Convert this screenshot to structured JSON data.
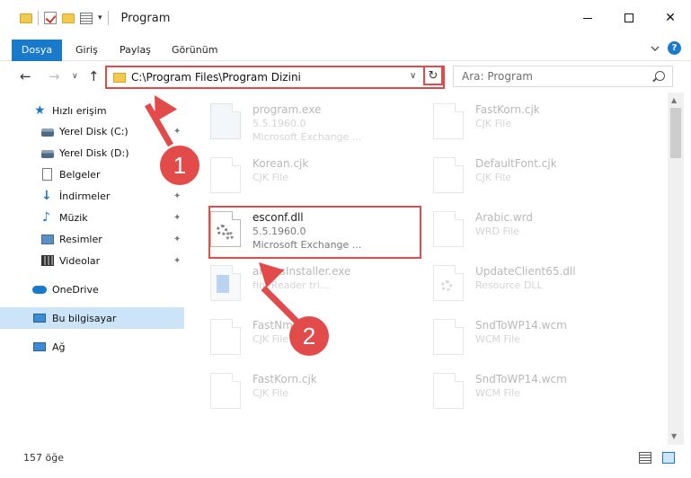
{
  "window": {
    "title": "Program",
    "minimize": "—",
    "close": "✕"
  },
  "ribbon": {
    "tabs": [
      "Dosya",
      "Giriş",
      "Paylaş",
      "Görünüm"
    ],
    "help": "?"
  },
  "nav": {
    "back": "←",
    "forward": "→",
    "recent": "∨",
    "up": "↑",
    "address": "C:\\Program Files\\Program Dizini",
    "address_dropdown": "∨",
    "refresh": "↻",
    "search_placeholder": "Ara: Program"
  },
  "sidebar": {
    "items": [
      {
        "label": "Hızlı erişim",
        "icon": "star-icon",
        "pinned": false
      },
      {
        "label": "Yerel Disk (C:)",
        "icon": "drive-icon",
        "pinned": true
      },
      {
        "label": "Yerel Disk (D:)",
        "icon": "drive-icon",
        "pinned": false
      },
      {
        "label": "Belgeler",
        "icon": "document-icon",
        "pinned": false
      },
      {
        "label": "İndirmeler",
        "icon": "download-icon",
        "pinned": true
      },
      {
        "label": "Müzik",
        "icon": "music-icon",
        "pinned": true
      },
      {
        "label": "Resimler",
        "icon": "pictures-icon",
        "pinned": true
      },
      {
        "label": "Videolar",
        "icon": "video-icon",
        "pinned": true
      },
      {
        "label": "OneDrive",
        "icon": "cloud-icon",
        "pinned": false
      },
      {
        "label": "Bu bilgisayar",
        "icon": "computer-icon",
        "pinned": false
      },
      {
        "label": "Ağ",
        "icon": "network-icon",
        "pinned": false
      }
    ],
    "pin_glyph": "📌"
  },
  "files": [
    {
      "name": "program.exe",
      "type": "5.5.1960.0",
      "desc": "Microsoft Exchange ..."
    },
    {
      "name": "FastKorn.cjk",
      "type": "CJK File",
      "desc": ""
    },
    {
      "name": "Korean.cjk",
      "type": "CJK File",
      "desc": ""
    },
    {
      "name": "DefaultFont.cjk",
      "type": "CJK File",
      "desc": ""
    },
    {
      "name": "esconf.dll",
      "type": "5.5.1960.0",
      "desc": "Microsoft Exchange ..."
    },
    {
      "name": "Arabic.wrd",
      "type": "WRD File",
      "desc": ""
    },
    {
      "name": "ammsInstaller.exe",
      "type": "fineReader tri...",
      "desc": ""
    },
    {
      "name": "UpdateClient65.dll",
      "type": "Resource DLL",
      "desc": ""
    },
    {
      "name": "FastNm",
      "type": "CJK File",
      "desc": ""
    },
    {
      "name": "SndToWP14.wcm",
      "type": "WCM File",
      "desc": ""
    },
    {
      "name": "FastKorn.cjk",
      "type": "CJK File",
      "desc": ""
    },
    {
      "name": "SndToWP14.wcm",
      "type": "WCM File",
      "desc": ""
    }
  ],
  "annotations": {
    "step1": "1",
    "step2": "2",
    "color": "#e34b4b"
  },
  "status": {
    "count": "157 öğe"
  },
  "colors": {
    "accent": "#1979ca",
    "selection": "#cce4f7"
  }
}
